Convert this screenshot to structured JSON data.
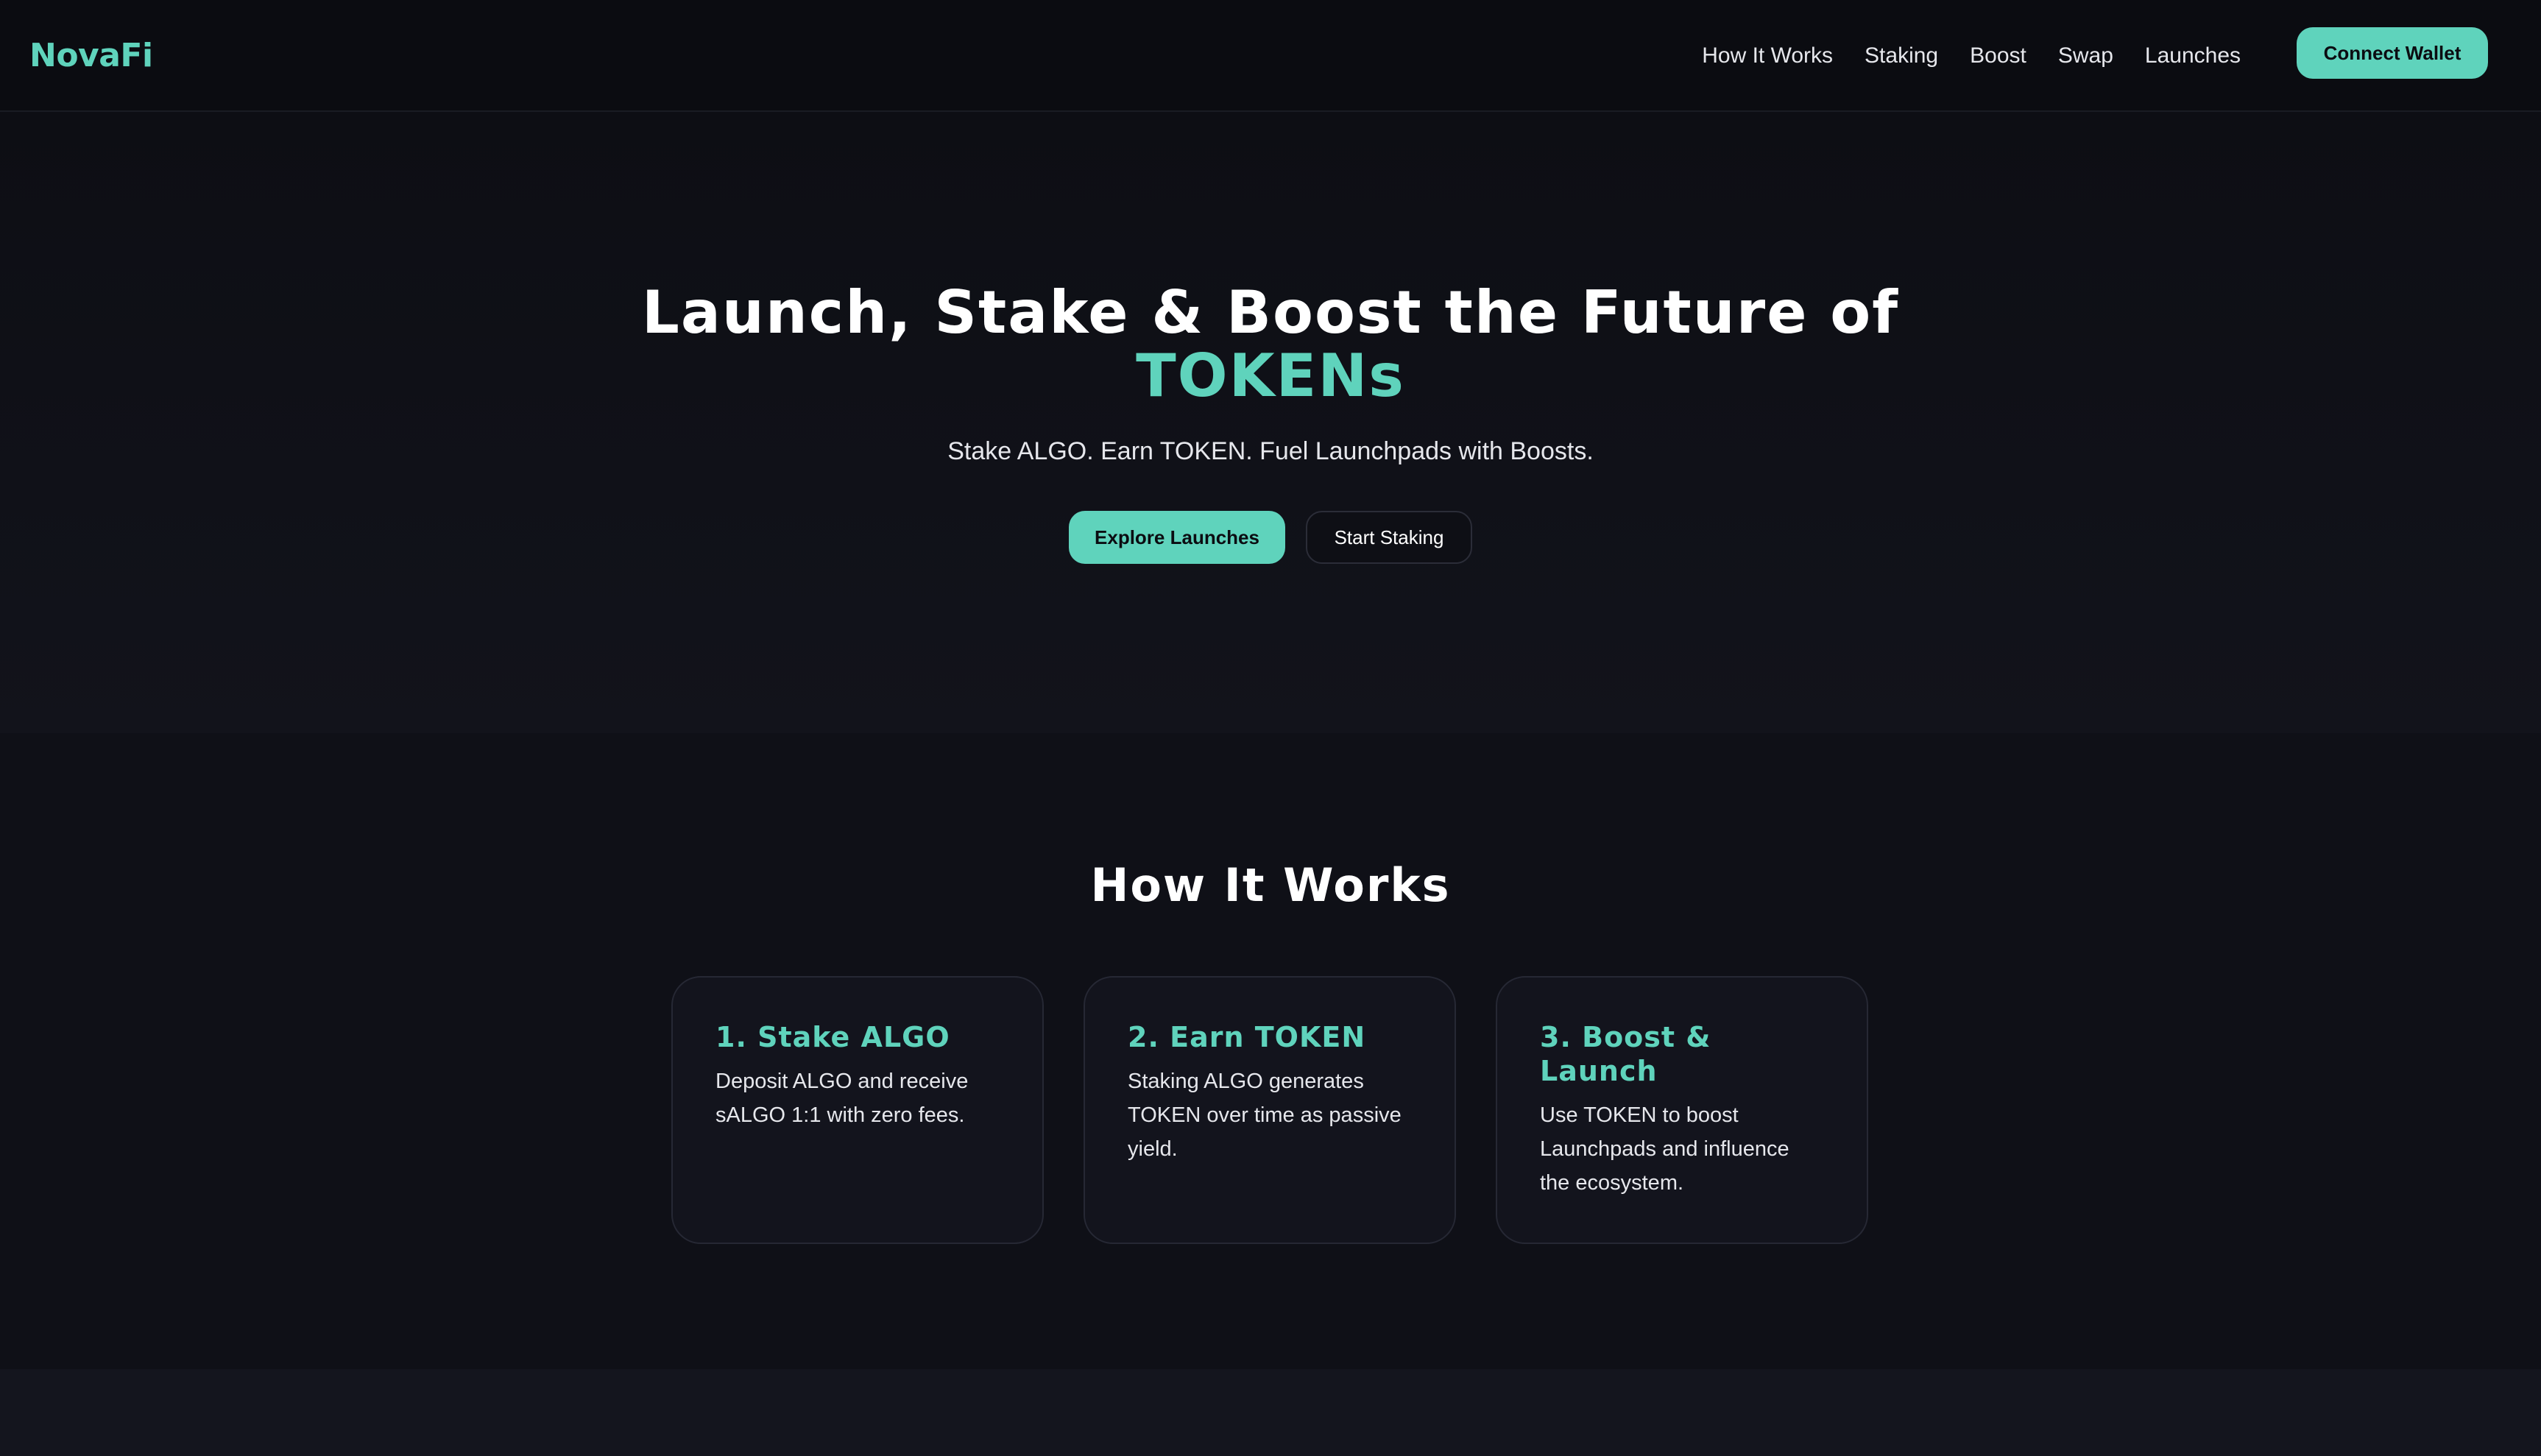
{
  "nav": {
    "logo": "NovaFi",
    "links": [
      "How It Works",
      "Staking",
      "Boost",
      "Swap",
      "Launches"
    ],
    "connect_label": "Connect Wallet"
  },
  "hero": {
    "title_line1": "Launch, Stake & Boost the Future of",
    "title_accent": "TOKENs",
    "subtitle": "Stake ALGO. Earn TOKEN. Fuel Launchpads with Boosts.",
    "primary_label": "Explore Launches",
    "secondary_label": "Start Staking"
  },
  "how": {
    "title": "How It Works",
    "cards": [
      {
        "title": "1. Stake ALGO",
        "text": "Deposit ALGO and receive sALGO 1:1 with zero fees."
      },
      {
        "title": "2. Earn TOKEN",
        "text": "Staking ALGO generates TOKEN over time as passive yield."
      },
      {
        "title": "3. Boost & Launch",
        "text": "Use TOKEN to boost Launchpads and influence the ecosystem."
      }
    ]
  },
  "colors": {
    "accent": "#5fd3bc",
    "background": "#0f1017"
  }
}
